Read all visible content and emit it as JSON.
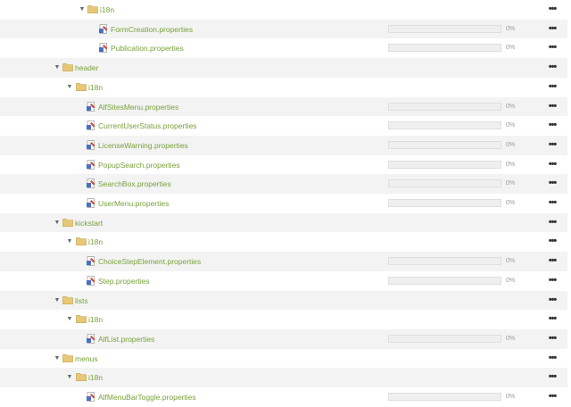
{
  "icons": {
    "expand": "triangle-down-icon",
    "folder": "folder-icon",
    "file": "properties-file-icon",
    "more": "more-options-icon"
  },
  "colors": {
    "link": "#78a13b",
    "row_alt": "#f3f3f3",
    "folder": "#e6c878",
    "file_icon_red": "#d04a3a",
    "file_icon_blue": "#4a6fc4"
  },
  "more_label": "•••",
  "tree": [
    {
      "type": "folder",
      "depth": 2,
      "name": "i18n",
      "expanded": true
    },
    {
      "type": "file",
      "depth": 3,
      "name": "FormCreation.properties",
      "progress": 0,
      "percent": "0%"
    },
    {
      "type": "file",
      "depth": 3,
      "name": "Publication.properties",
      "progress": 0,
      "percent": "0%"
    },
    {
      "type": "folder",
      "depth": 1,
      "name": "header",
      "expanded": true
    },
    {
      "type": "folder",
      "depth": 2,
      "name": "i18n",
      "expanded": true
    },
    {
      "type": "file",
      "depth": 3,
      "name": "AlfSitesMenu.properties",
      "progress": 0,
      "percent": "0%"
    },
    {
      "type": "file",
      "depth": 3,
      "name": "CurrentUserStatus.properties",
      "progress": 0,
      "percent": "0%"
    },
    {
      "type": "file",
      "depth": 3,
      "name": "LicenseWarning.properties",
      "progress": 0,
      "percent": "0%"
    },
    {
      "type": "file",
      "depth": 3,
      "name": "PopupSearch.properties",
      "progress": 0,
      "percent": "0%"
    },
    {
      "type": "file",
      "depth": 3,
      "name": "SearchBox.properties",
      "progress": 0,
      "percent": "0%"
    },
    {
      "type": "file",
      "depth": 3,
      "name": "UserMenu.properties",
      "progress": 0,
      "percent": "0%"
    },
    {
      "type": "folder",
      "depth": 1,
      "name": "kickstart",
      "expanded": true
    },
    {
      "type": "folder",
      "depth": 2,
      "name": "i18n",
      "expanded": true
    },
    {
      "type": "file",
      "depth": 3,
      "name": "ChoiceStepElement.properties",
      "progress": 0,
      "percent": "0%"
    },
    {
      "type": "file",
      "depth": 3,
      "name": "Step.properties",
      "progress": 0,
      "percent": "0%"
    },
    {
      "type": "folder",
      "depth": 1,
      "name": "lists",
      "expanded": true
    },
    {
      "type": "folder",
      "depth": 2,
      "name": "i18n",
      "expanded": true
    },
    {
      "type": "file",
      "depth": 3,
      "name": "AlfList.properties",
      "progress": 0,
      "percent": "0%"
    },
    {
      "type": "folder",
      "depth": 1,
      "name": "menus",
      "expanded": true
    },
    {
      "type": "folder",
      "depth": 2,
      "name": "i18n",
      "expanded": true
    },
    {
      "type": "file",
      "depth": 3,
      "name": "AlfMenuBarToggle.properties",
      "progress": 0,
      "percent": "0%"
    }
  ]
}
